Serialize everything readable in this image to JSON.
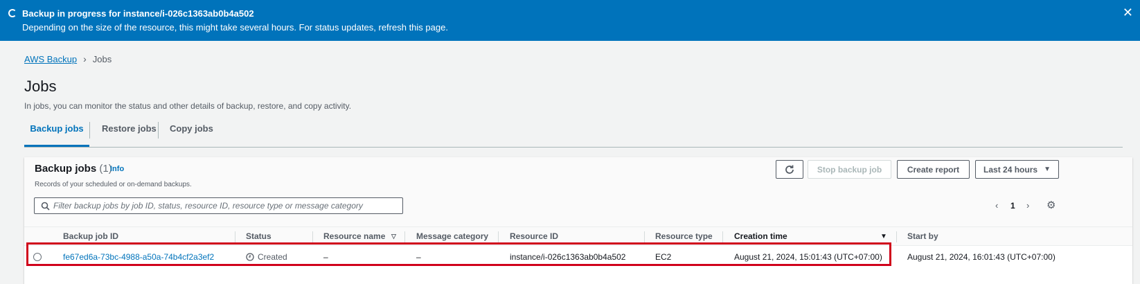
{
  "flash": {
    "title": "Backup in progress for instance/i-026c1363ab0b4a502",
    "message": "Depending on the size of the resource, this might take several hours. For status updates, refresh this page.",
    "close_icon": "close-icon",
    "background": "#0073bb"
  },
  "breadcrumb": {
    "root": "AWS Backup",
    "current": "Jobs"
  },
  "page": {
    "title": "Jobs",
    "description": "In jobs, you can monitor the status and other details of backup, restore, and copy activity."
  },
  "tabs": [
    {
      "label": "Backup jobs",
      "active": true
    },
    {
      "label": "Restore jobs",
      "active": false
    },
    {
      "label": "Copy jobs",
      "active": false
    }
  ],
  "panel": {
    "title": "Backup jobs",
    "count": "(1)",
    "info": "Info",
    "description": "Records of your scheduled or on-demand backups.",
    "refresh_icon": "refresh-icon",
    "stop_label": "Stop backup job",
    "report_label": "Create report",
    "range_label": "Last 24 hours",
    "search_placeholder": "Filter backup jobs by job ID, status, resource ID, resource type or message category",
    "page_number": "1"
  },
  "table": {
    "columns": [
      "Backup job ID",
      "Status",
      "Resource name",
      "Message category",
      "Resource ID",
      "Resource type",
      "Creation time",
      "Start by"
    ],
    "rows": [
      {
        "job_id": "fe67ed6a-73bc-4988-a50a-74b4cf2a3ef2",
        "status": "Created",
        "resource_name": "–",
        "message_category": "–",
        "resource_id": "instance/i-026c1363ab0b4a502",
        "resource_type": "EC2",
        "creation_time": "August 21, 2024, 15:01:43 (UTC+07:00)",
        "start_by": "August 21, 2024, 16:01:43 (UTC+07:00)"
      }
    ]
  },
  "colors": {
    "accent": "#0073bb",
    "highlight": "#d0021b"
  }
}
